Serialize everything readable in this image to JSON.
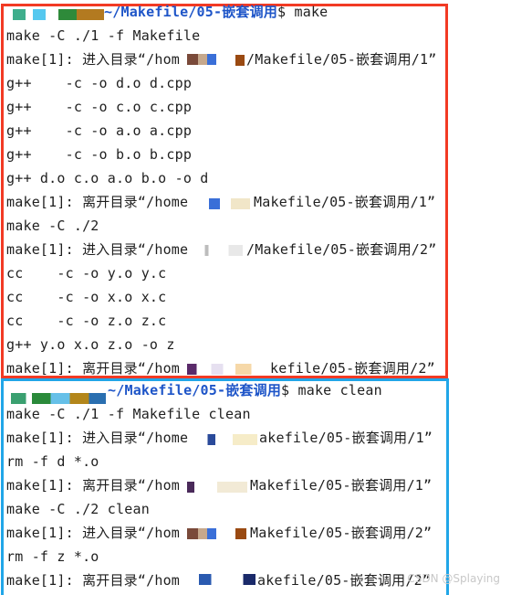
{
  "colors": {
    "make_section_border": "#f23a24",
    "clean_section_border": "#21a6e8",
    "prompt_path": "#1e55c8",
    "text": "#1f1f1f"
  },
  "make_section": {
    "prompt_path": "~/Makefile/05-嵌套调用",
    "prompt_command": "$ make",
    "lines": [
      "make -C ./1 -f Makefile",
      "make[1]: 进入目录“/hom",
      "/Makefile/05-嵌套调用/1”",
      "g++    -c -o d.o d.cpp",
      "g++    -c -o c.o c.cpp",
      "g++    -c -o a.o a.cpp",
      "g++    -c -o b.o b.cpp",
      "g++ d.o c.o a.o b.o -o d",
      "make[1]: 离开目录“/home",
      "Makefile/05-嵌套调用/1”",
      "make -C ./2",
      "make[1]: 进入目录“/home",
      "/Makefile/05-嵌套调用/2”",
      "cc    -c -o y.o y.c",
      "cc    -c -o x.o x.c",
      "cc    -c -o z.o z.c",
      "g++ y.o x.o z.o -o z",
      "make[1]: 离开目录“/hom",
      "kefile/05-嵌套调用/2”"
    ]
  },
  "clean_section": {
    "prompt_path": "~/Makefile/05-嵌套调用",
    "prompt_command": "$ make clean",
    "lines": [
      "make -C ./1 -f Makefile clean",
      "make[1]: 进入目录“/home",
      "akefile/05-嵌套调用/1”",
      "rm -f d *.o",
      "make[1]: 离开目录“/hom",
      "Makefile/05-嵌套调用/1”",
      "make -C ./2 clean",
      "make[1]: 进入目录“/hom",
      "Makefile/05-嵌套调用/2”",
      "rm -f z *.o",
      "make[1]: 离开目录“/hom",
      "akefile/05-嵌套调用/2”"
    ]
  },
  "watermark": "CSDN @Splaying"
}
